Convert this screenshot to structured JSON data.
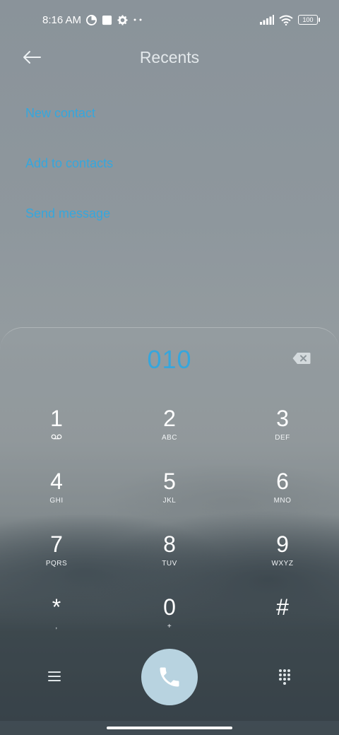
{
  "status": {
    "time": "8:16 AM",
    "battery": "100",
    "icons": [
      "data-saver-icon",
      "square-notification-icon",
      "settings-icon",
      "more-dots-icon",
      "signal-icon",
      "wifi-icon",
      "battery-icon"
    ]
  },
  "header": {
    "title": "Recents"
  },
  "actions": [
    {
      "label": "New contact"
    },
    {
      "label": "Add to contacts"
    },
    {
      "label": "Send message"
    }
  ],
  "dialpad": {
    "number": "010",
    "keys": [
      [
        {
          "digit": "1",
          "sub": ""
        },
        {
          "digit": "2",
          "sub": "ABC"
        },
        {
          "digit": "3",
          "sub": "DEF"
        }
      ],
      [
        {
          "digit": "4",
          "sub": "GHI"
        },
        {
          "digit": "5",
          "sub": "JKL"
        },
        {
          "digit": "6",
          "sub": "MNO"
        }
      ],
      [
        {
          "digit": "7",
          "sub": "PQRS"
        },
        {
          "digit": "8",
          "sub": "TUV"
        },
        {
          "digit": "9",
          "sub": "WXYZ"
        }
      ],
      [
        {
          "digit": "*",
          "sub": ","
        },
        {
          "digit": "0",
          "sub": "+"
        },
        {
          "digit": "#",
          "sub": ""
        }
      ]
    ]
  },
  "colors": {
    "accent": "#35a7dd",
    "call_button": "#b8d3e0"
  }
}
